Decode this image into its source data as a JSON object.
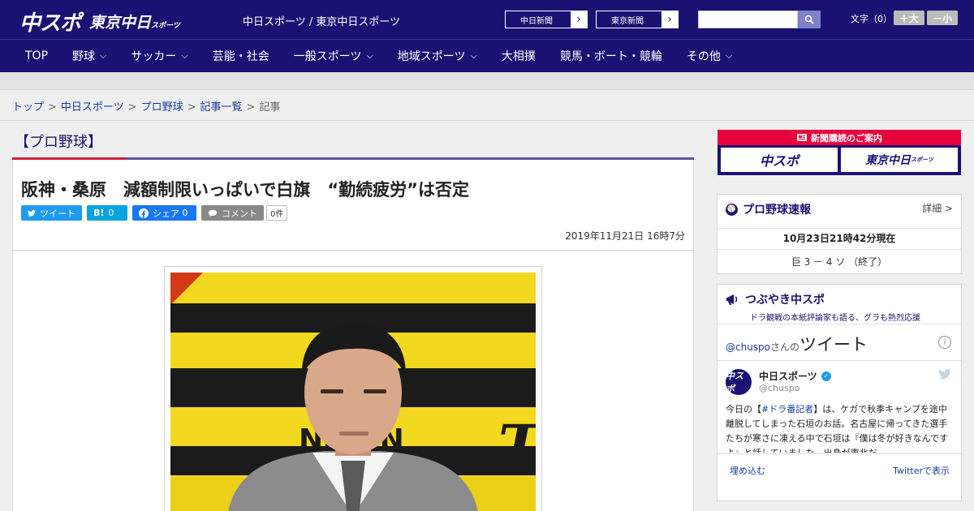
{
  "header": {
    "logo_chuspo": "中スポ",
    "logo_tokyo": "東京中日",
    "logo_tokyo_sub": "スポーツ",
    "site_title": "中日スポーツ / 東京中日スポーツ",
    "paper_links": [
      "中日新聞",
      "東京新聞"
    ],
    "search_placeholder": "",
    "font_size_label": "文字（0）",
    "font_plus": "＋大",
    "font_minus": "－小"
  },
  "nav": {
    "items": [
      {
        "label": "TOP",
        "has_menu": false
      },
      {
        "label": "野球",
        "has_menu": true
      },
      {
        "label": "サッカー",
        "has_menu": true
      },
      {
        "label": "芸能・社会",
        "has_menu": false
      },
      {
        "label": "一般スポーツ",
        "has_menu": true
      },
      {
        "label": "地域スポーツ",
        "has_menu": true
      },
      {
        "label": "大相撲",
        "has_menu": false
      },
      {
        "label": "競馬・ボート・競輪",
        "has_menu": false
      },
      {
        "label": "その他",
        "has_menu": true
      }
    ]
  },
  "breadcrumb": {
    "links": [
      "トップ",
      "中日スポーツ",
      "プロ野球",
      "記事一覧"
    ],
    "current": "記事",
    "separator": ">"
  },
  "article": {
    "category": "【プロ野球】",
    "headline": "阪神・桑原　減額制限いっぱいで白旗　“勤続疲労”は否定",
    "share": {
      "tweet": "ツイート",
      "hatena_icon": "B!",
      "hatena_count": "0",
      "facebook": "シェア",
      "facebook_count": "0",
      "comment": "コメント",
      "comment_count": "0件"
    },
    "date": "2019年11月21日 16時7分",
    "photo_text": "NSHIN",
    "photo_num": "T"
  },
  "sidebar": {
    "ad": {
      "title": "新聞購読のご案内",
      "left": "中スポ",
      "right": "東京中日",
      "right_sub": "スポーツ"
    },
    "scores": {
      "title": "プロ野球速報",
      "detail": "詳細 >",
      "as_of": "10月23日21時42分現在",
      "game": "巨 3 － 4 ソ （終了）"
    },
    "tweets": {
      "title": "つぶやき中スポ",
      "subtitle": "ドラ観戦の本紙評論家も語る、グラも熱烈応援",
      "handle_link": "@chuspo",
      "san_no": "さんの",
      "header_big": "ツイート",
      "account_name": "中日スポーツ",
      "account_handle": "@chuspo",
      "avatar_text": "中スポ",
      "tweet_prefix": "今日の【",
      "tweet_tag": "#ドラ番記者",
      "tweet_body": "】は、ケガで秋季キャンプを途中離脱してしまった石垣のお話。名古屋に帰ってきた選手たちが寒さに凍える中で石垣は『僕は冬が好きなんですよ』と話していました。出身が東北だ",
      "embed": "埋め込む",
      "view_on": "Twitterで表示"
    }
  }
}
